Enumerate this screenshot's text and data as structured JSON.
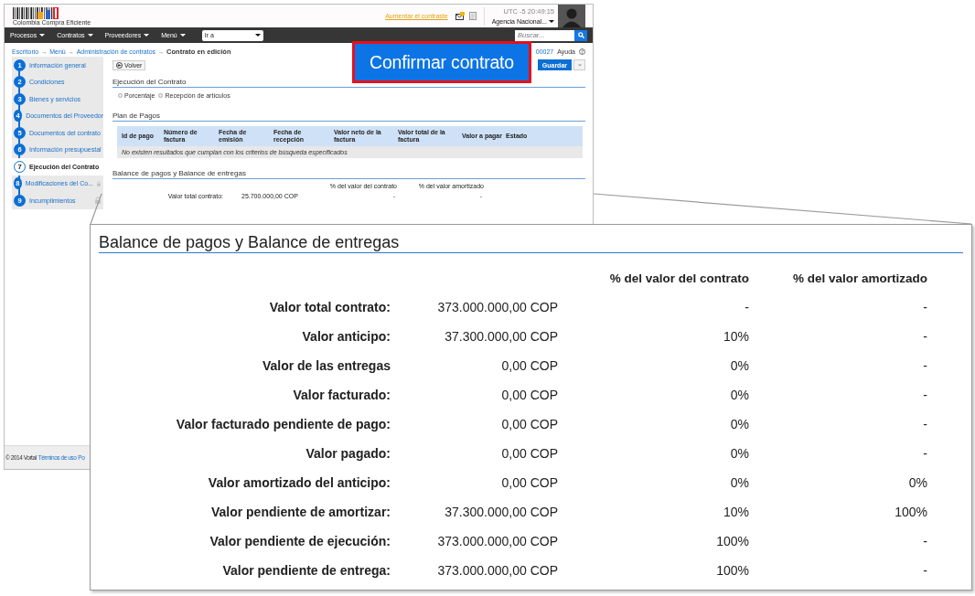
{
  "header": {
    "logo_text": "Colombia Compra Eficiente",
    "contrast_link": "Aumentar el contraste",
    "clock": "UTC -5 20:49:15",
    "user": "Agencia Nacional..."
  },
  "nav": {
    "menus": [
      "Procesos",
      "Contratos",
      "Proveedores",
      "Menú"
    ],
    "goto": {
      "value": "Ir a"
    },
    "search": {
      "placeholder": "Buscar..."
    }
  },
  "breadcrumb": {
    "items": [
      "Escritorio",
      "Menú",
      "Administración de contratos",
      "Contrato en edición"
    ],
    "separator": "→"
  },
  "process_number": "00027",
  "help": "Ayuda",
  "confirm_button": "Confirmar contrato",
  "save_button": "Guardar",
  "steps": [
    {
      "number": "1",
      "label": "Información general",
      "selected": false,
      "locked": false
    },
    {
      "number": "2",
      "label": "Condiciones",
      "selected": false,
      "locked": false
    },
    {
      "number": "3",
      "label": "Bienes y servicios",
      "selected": false,
      "locked": false
    },
    {
      "number": "4",
      "label": "Documentos del Proveedor",
      "selected": false,
      "locked": false
    },
    {
      "number": "5",
      "label": "Documentos del contrato",
      "selected": false,
      "locked": false
    },
    {
      "number": "6",
      "label": "Información presupuestal",
      "selected": false,
      "locked": false
    },
    {
      "number": "7",
      "label": "Ejecución del Contrato",
      "selected": true,
      "locked": false
    },
    {
      "number": "8",
      "label": "Modificaciones del Co...",
      "selected": false,
      "locked": true
    },
    {
      "number": "9",
      "label": "Incumplimientos",
      "selected": false,
      "locked": true
    }
  ],
  "back_button": "Volver",
  "execution": {
    "title": "Ejecución del Contrato",
    "options": [
      {
        "label": "Porcentaje",
        "selected": false
      },
      {
        "label": "Recepción de artículos",
        "selected": false
      }
    ]
  },
  "payment_plan": {
    "title": "Plan de Pagos",
    "columns": [
      "Id de pago",
      "Número de factura",
      "Fecha de emisión",
      "Fecha de recepción",
      "Valor neto de la factura",
      "Valor total de la factura",
      "Valor a pagar",
      "Estado"
    ],
    "empty_message": "No existen resultados que cumplan con los criterios de búsqueda especificados"
  },
  "balance_small": {
    "title": "Balance de pagos y Balance de entregas",
    "columns": [
      "% del valor del contrato",
      "% del valor amortizado"
    ],
    "rows": [
      {
        "label": "Valor total contrato:",
        "value": "25.700.000,00 COP",
        "contract_pct": "-",
        "amortized_pct": "-"
      }
    ]
  },
  "footer": {
    "copyright": "© 2014 Vortal",
    "links": [
      "Términos de uso",
      "Po"
    ]
  },
  "zoom_panel": {
    "title": "Balance de pagos y Balance de entregas",
    "columns": [
      "% del valor del contrato",
      "% del valor amortizado"
    ],
    "rows": [
      {
        "label": "Valor total contrato:",
        "value": "373.000.000,00 COP",
        "contract_pct": "-",
        "amortized_pct": "-"
      },
      {
        "label": "Valor anticipo:",
        "value": "37.300.000,00 COP",
        "contract_pct": "10%",
        "amortized_pct": "-"
      },
      {
        "label": "Valor de las entregas",
        "value": "0,00 COP",
        "contract_pct": "0%",
        "amortized_pct": "-"
      },
      {
        "label": "Valor facturado:",
        "value": "0,00 COP",
        "contract_pct": "0%",
        "amortized_pct": "-"
      },
      {
        "label": "Valor facturado pendiente de pago:",
        "value": "0,00 COP",
        "contract_pct": "0%",
        "amortized_pct": "-"
      },
      {
        "label": "Valor pagado:",
        "value": "0,00 COP",
        "contract_pct": "0%",
        "amortized_pct": "-"
      },
      {
        "label": "Valor amortizado del anticipo:",
        "value": "0,00 COP",
        "contract_pct": "0%",
        "amortized_pct": "0%"
      },
      {
        "label": "Valor pendiente de amortizar:",
        "value": "37.300.000,00 COP",
        "contract_pct": "10%",
        "amortized_pct": "100%"
      },
      {
        "label": "Valor pendiente de ejecución:",
        "value": "373.000.000,00 COP",
        "contract_pct": "100%",
        "amortized_pct": "-"
      },
      {
        "label": "Valor pendiente de entrega:",
        "value": "373.000.000,00 COP",
        "contract_pct": "100%",
        "amortized_pct": "-"
      }
    ]
  }
}
